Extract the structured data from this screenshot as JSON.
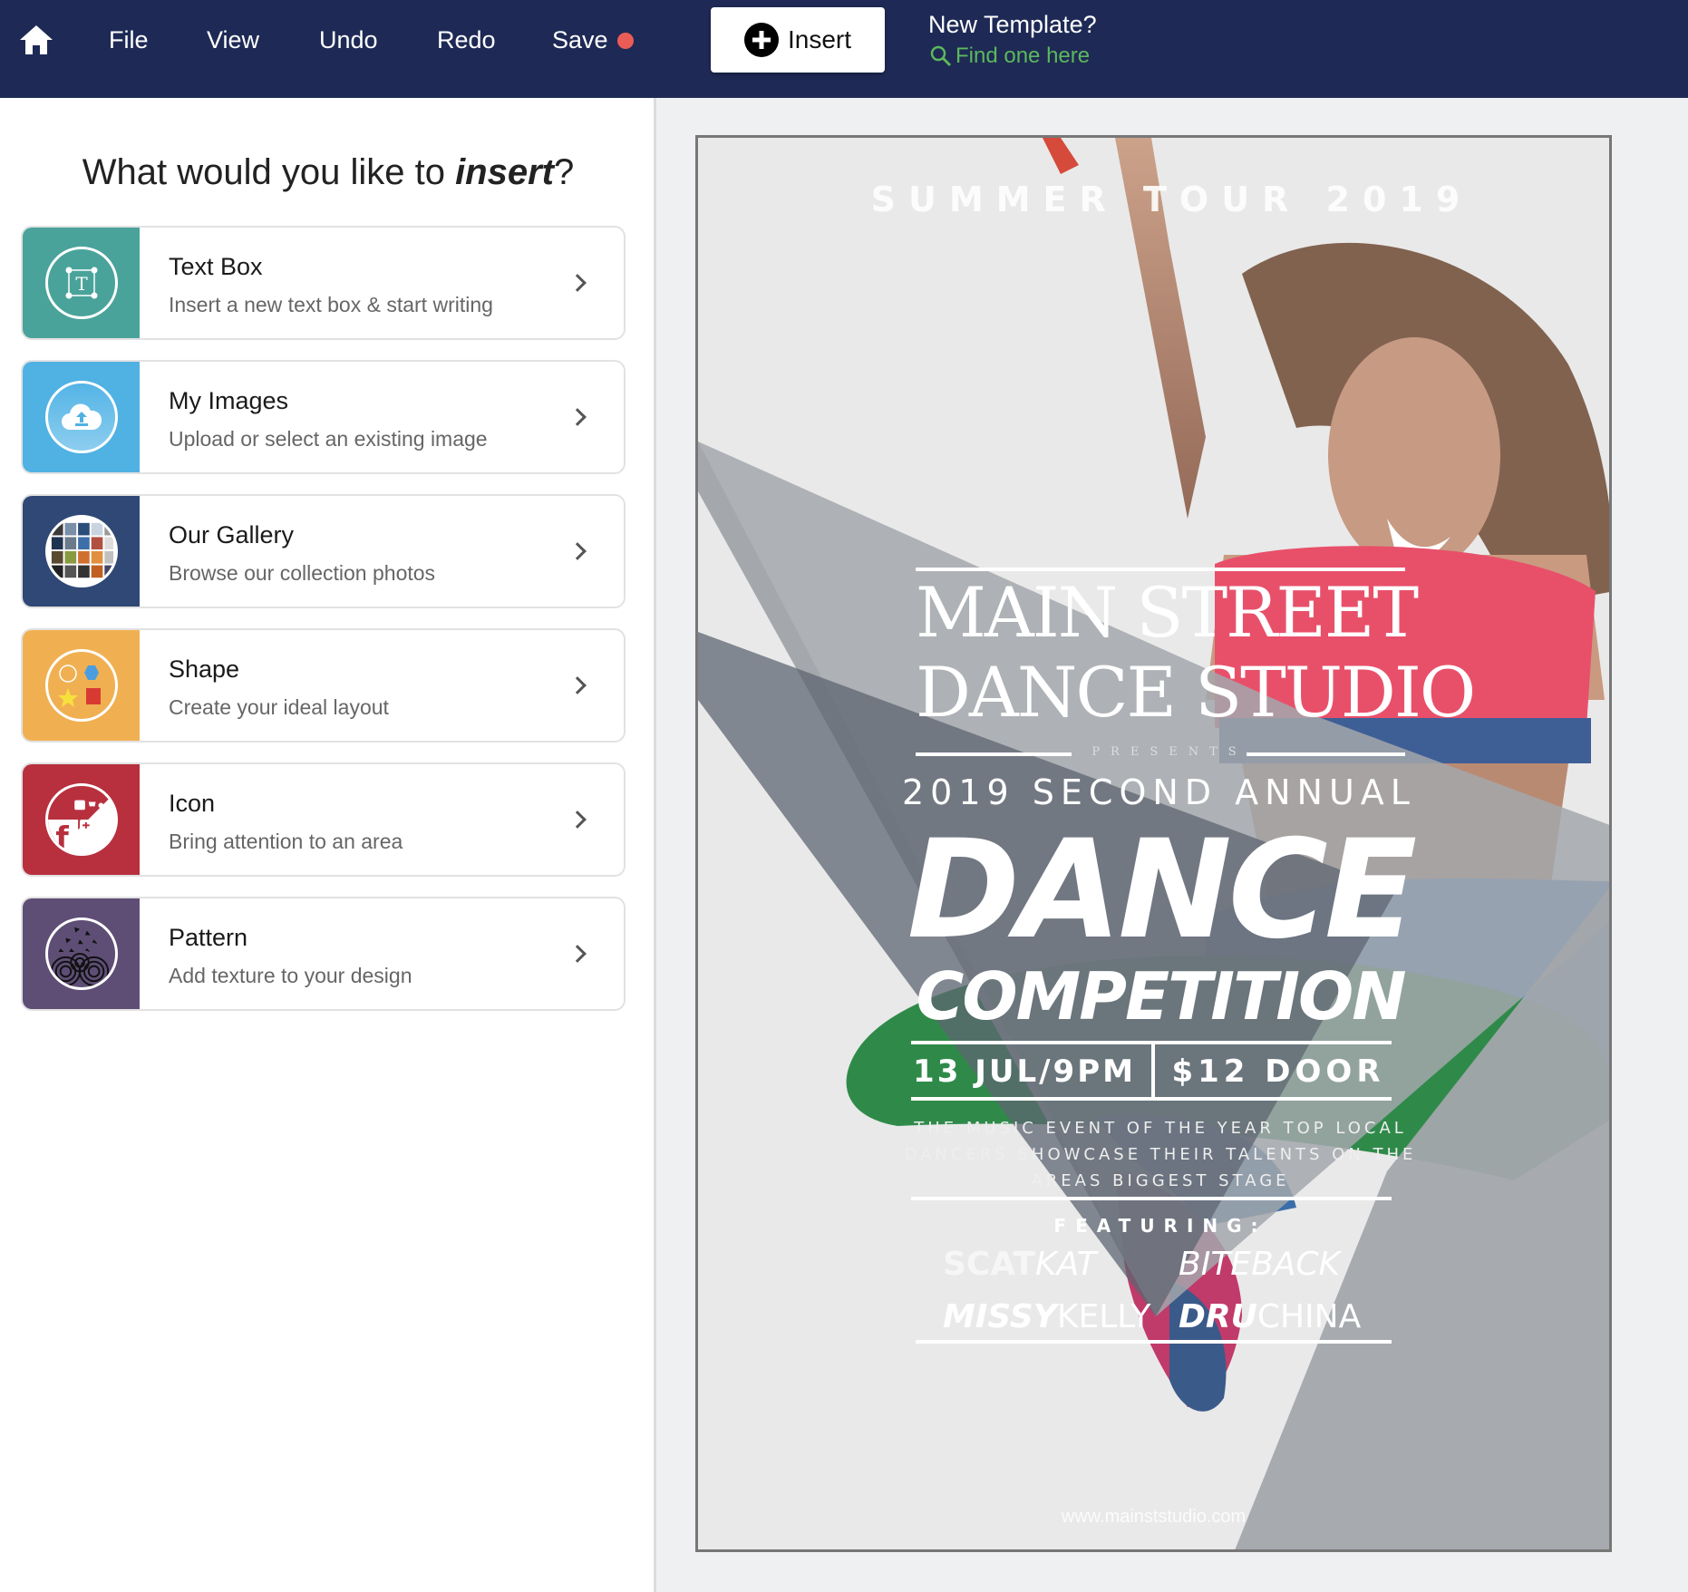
{
  "header": {
    "nav": [
      "File",
      "View",
      "Undo",
      "Redo",
      "Save"
    ],
    "save_unsaved_indicator_color": "#ec5c57",
    "insert_button": "Insert",
    "template_prompt": "New Template?",
    "template_link": "Find one here",
    "bg_color": "#1e2a55",
    "link_color": "#5cb85c"
  },
  "panel": {
    "title_prefix": "What would you like to ",
    "title_emphasis": "insert",
    "title_suffix": "?",
    "items": [
      {
        "title": "Text Box",
        "desc": "Insert a new text box & start writing",
        "color": "#4aa39b",
        "icon": "text-box-icon"
      },
      {
        "title": "My Images",
        "desc": "Upload or select an existing image",
        "color": "#50b1e3",
        "icon": "cloud-upload-icon"
      },
      {
        "title": "Our Gallery",
        "desc": "Browse our collection photos",
        "color": "#304876",
        "icon": "gallery-icon"
      },
      {
        "title": "Shape",
        "desc": "Create your ideal layout",
        "color": "#f0b052",
        "icon": "shapes-icon"
      },
      {
        "title": "Icon",
        "desc": "Bring attention to an area",
        "color": "#b8303e",
        "icon": "social-icons-icon"
      },
      {
        "title": "Pattern",
        "desc": "Add texture to your design",
        "color": "#5e4e76",
        "icon": "pattern-icon"
      }
    ]
  },
  "poster": {
    "tagline": "SUMMER TOUR 2019",
    "studio_line1": "MAIN STREET",
    "studio_line2": "DANCE STUDIO",
    "presents": "PRESENTS",
    "subtitle": "2019 SECOND ANNUAL",
    "headline": "DANCE",
    "headline2": "COMPETITION",
    "date": "13 JUL/9PM",
    "price": "$12 DOOR",
    "blurb": "THE MUSIC EVENT OF THE YEAR TOP LOCAL DANCERS SHOWCASE THEIR TALENTS ON THE AREAS BIGGEST STAGE",
    "featuring": "FEATURING:",
    "performers": [
      {
        "a": "SCAT",
        "b": "KAT"
      },
      {
        "a": "BITE",
        "b": "BACK"
      },
      {
        "a": "MISSY",
        "b": "KELLY"
      },
      {
        "a": "DRU",
        "b": "CHINA"
      }
    ],
    "url": "www.mainststudio.com"
  }
}
